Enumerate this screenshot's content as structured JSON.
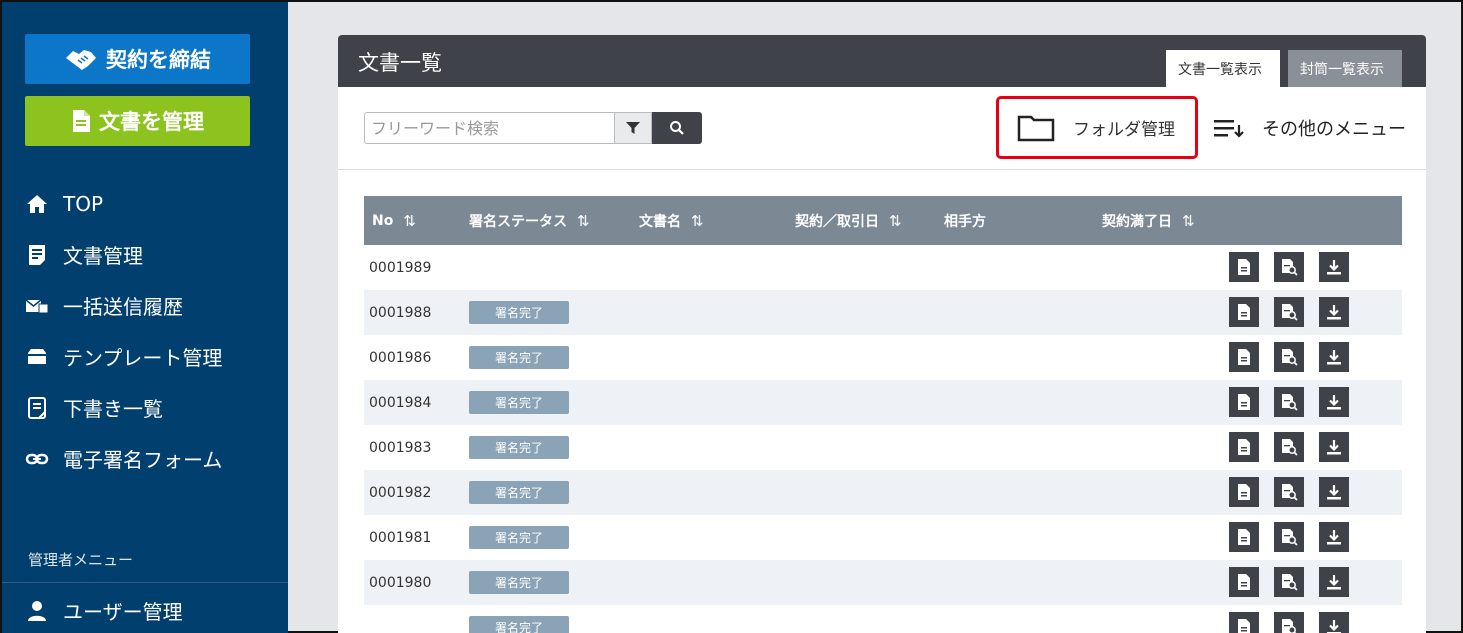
{
  "sidebar": {
    "contract_button": "契約を締結",
    "manage_button": "文書を管理",
    "items": [
      {
        "label": "TOP",
        "icon": "home-icon"
      },
      {
        "label": "文書管理",
        "icon": "document-list-icon"
      },
      {
        "label": "一括送信履歴",
        "icon": "bulk-send-icon"
      },
      {
        "label": "テンプレート管理",
        "icon": "template-icon"
      },
      {
        "label": "下書き一覧",
        "icon": "draft-icon"
      },
      {
        "label": "電子署名フォーム",
        "icon": "link-icon"
      }
    ],
    "admin_label": "管理者メニュー",
    "user_management": "ユーザー管理"
  },
  "panel": {
    "title": "文書一覧",
    "tabs": [
      "文書一覧表示",
      "封筒一覧表示"
    ],
    "search_placeholder": "フリーワード検索",
    "folder_management": "フォルダ管理",
    "other_menu": "その他のメニュー"
  },
  "table": {
    "headers": [
      "No",
      "署名ステータス",
      "文書名",
      "契約／取引日",
      "相手方",
      "契約満了日"
    ],
    "sort_glyph": "⇅",
    "rows": [
      {
        "no": "0001989",
        "status": ""
      },
      {
        "no": "0001988",
        "status": "署名完了"
      },
      {
        "no": "0001986",
        "status": "署名完了"
      },
      {
        "no": "0001984",
        "status": "署名完了"
      },
      {
        "no": "0001983",
        "status": "署名完了"
      },
      {
        "no": "0001982",
        "status": "署名完了"
      },
      {
        "no": "0001981",
        "status": "署名完了"
      },
      {
        "no": "0001980",
        "status": "署名完了"
      },
      {
        "no": "",
        "status": "署名完了"
      }
    ]
  },
  "colors": {
    "sidebar_bg": "#003f6e",
    "contract_button_bg": "#0c76c9",
    "manage_button_bg": "#8cc31e",
    "header_bg": "#3f4349",
    "table_header_bg": "#7c8894",
    "badge_bg": "#8ba3b6",
    "highlight_border": "#e60012"
  }
}
